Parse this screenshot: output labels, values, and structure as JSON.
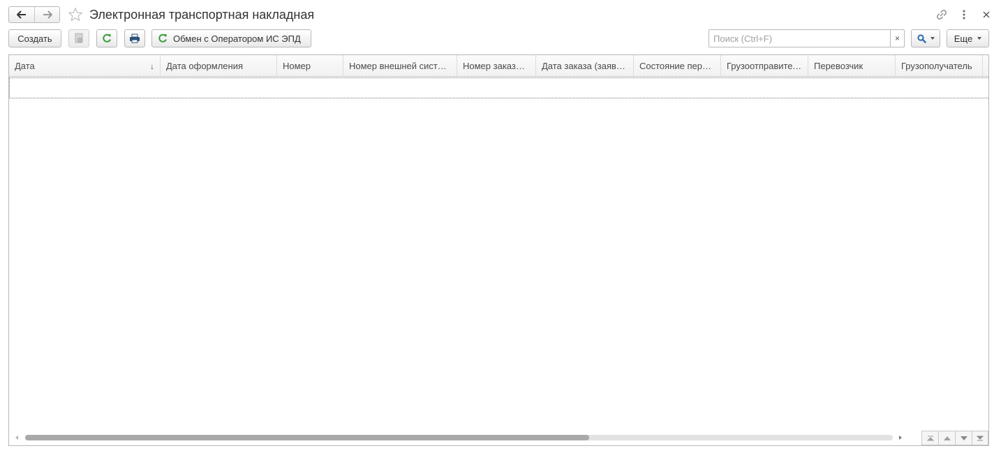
{
  "window": {
    "title": "Электронная транспортная накладная"
  },
  "toolbar": {
    "create_label": "Создать",
    "exchange_label": "Обмен с Оператором ИС ЭПД",
    "search_placeholder": "Поиск (Ctrl+F)",
    "search_value": "",
    "clear_glyph": "×",
    "more_label": "Еще"
  },
  "table": {
    "columns": [
      {
        "label": "Дата",
        "sort_glyph": "↓"
      },
      {
        "label": "Дата оформления"
      },
      {
        "label": "Номер"
      },
      {
        "label": "Номер внешней системы"
      },
      {
        "label": "Номер заказа (заявки)"
      },
      {
        "label": "Дата заказа (заявки)"
      },
      {
        "label": "Состояние перевозки"
      },
      {
        "label": "Грузоотправитель"
      },
      {
        "label": "Перевозчик"
      },
      {
        "label": "Грузополучатель"
      }
    ],
    "rows": []
  },
  "scrollbar": {
    "position": 0,
    "visible_fraction": 0.65
  },
  "colors": {
    "accent_green": "#3a9b3a",
    "accent_blue": "#2b6cb0",
    "border": "#b8b8b8"
  },
  "icons": {
    "back": "arrow-left-icon",
    "forward": "arrow-right-icon",
    "favorite": "star-icon",
    "link": "link-icon",
    "menu": "kebab-menu-icon",
    "close": "close-icon",
    "copy": "copy-document-icon",
    "refresh": "refresh-icon",
    "print": "printer-icon",
    "search": "search-icon"
  }
}
